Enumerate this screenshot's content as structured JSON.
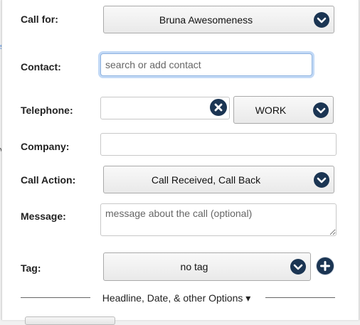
{
  "form": {
    "call_for": {
      "label": "Call for:",
      "value": "Bruna Awesomeness"
    },
    "contact": {
      "label": "Contact:",
      "placeholder": "search or add contact"
    },
    "telephone": {
      "label": "Telephone:",
      "value": "",
      "type": "WORK"
    },
    "company": {
      "label": "Company:",
      "value": ""
    },
    "call_action": {
      "label": "Call Action:",
      "value": "Call Received, Call Back"
    },
    "message": {
      "label": "Message:",
      "placeholder": "message about the call (optional)"
    },
    "tag": {
      "label": "Tag:",
      "value": "no tag"
    },
    "options_toggle": {
      "label": "Headline, Date, & other Options",
      "arrow": "▾"
    }
  },
  "icons": {
    "dropdown": "chevron-down-icon",
    "clear": "close-icon",
    "add": "plus-icon"
  },
  "colors": {
    "accent": "#1b3553",
    "focus_ring": "#78aaeb"
  }
}
